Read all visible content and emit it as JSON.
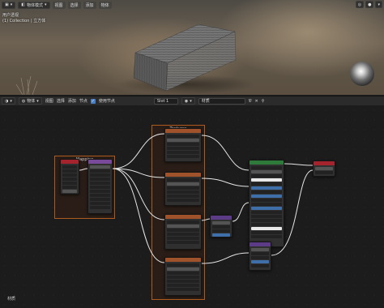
{
  "viewport": {
    "mode_label": "物体模式",
    "menus": [
      "视图",
      "选择",
      "添加",
      "物体"
    ],
    "info_line1": "用户透视",
    "info_line2": "(1) Collection | 立方体"
  },
  "node_header": {
    "object_label": "物体",
    "menus": [
      "视图",
      "选择",
      "添加",
      "节点"
    ],
    "use_nodes_label": "使用节点",
    "slot_label": "Slot 1",
    "material_name": "材质"
  },
  "canvas": {
    "frames": {
      "left_title": "Mapping",
      "center_title": "Textures"
    },
    "bottom_label": "材质"
  },
  "colors": {
    "frame_border": "#ad5a1e",
    "texture_header": "#a0532b",
    "bsdf_header": "#2e7a3a",
    "output_header": "#a5232d",
    "link": "#e5e5e5"
  }
}
